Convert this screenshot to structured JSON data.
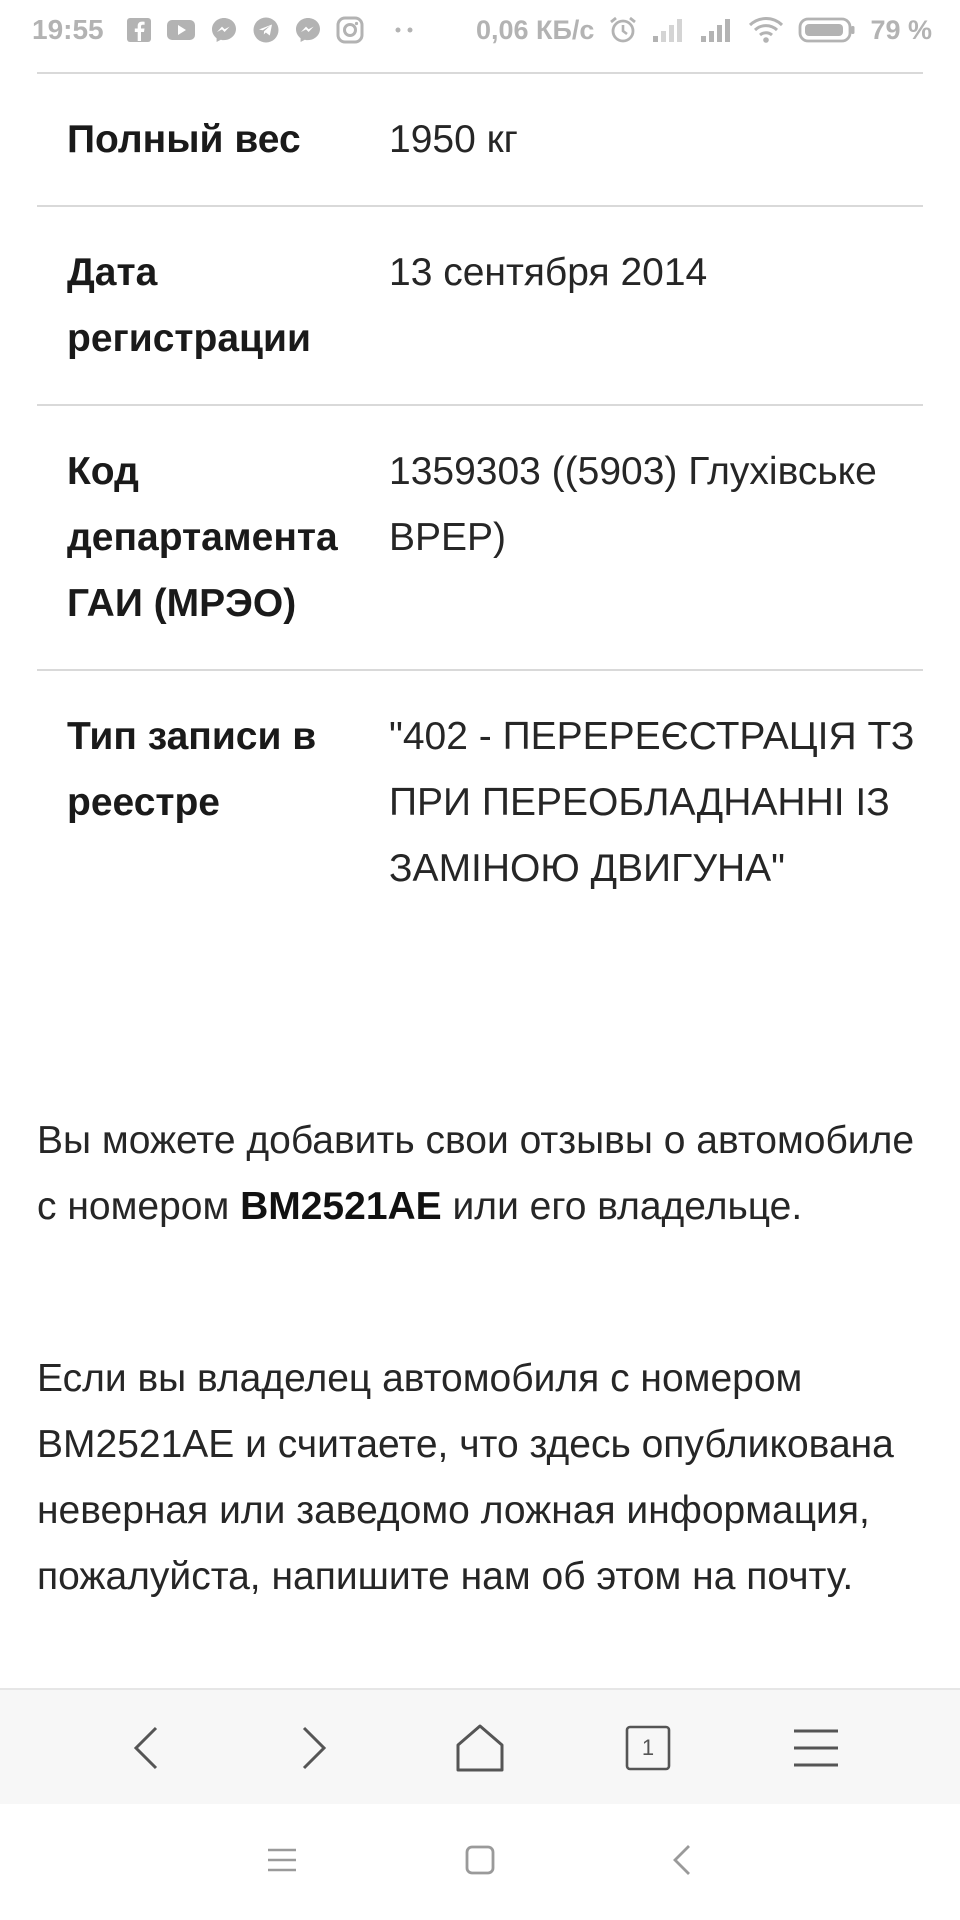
{
  "status_bar": {
    "time": "19:55",
    "network_speed": "0,06 КБ/с",
    "battery_percent": "79 %",
    "left_icons": [
      "facebook-icon",
      "youtube-icon",
      "messenger-icon",
      "telegram-icon",
      "messenger-icon",
      "instagram-icon",
      "more-notifications-icon"
    ],
    "right_icons": [
      "alarm-icon",
      "signal-icon",
      "signal-icon",
      "wifi-icon",
      "battery-icon"
    ]
  },
  "table": {
    "rows": [
      {
        "label": "Полный вес",
        "value": "1950 кг"
      },
      {
        "label": "Дата регистрации",
        "value": "13 сентября 2014"
      },
      {
        "label": "Код департамента ГАИ (МРЭО)",
        "value": "1359303 ((5903) Глухівське ВРЕР)"
      },
      {
        "label": "Тип записи в реестре",
        "value": "\"402 - ПЕРЕРЕЄСТРАЦІЯ ТЗ ПРИ ПЕРЕОБЛАДНАННІ ІЗ ЗАМІНОЮ ДВИГУНА\""
      }
    ]
  },
  "reviews_paragraph": {
    "before": "Вы можете добавить свои отзывы о автомобиле с номером ",
    "plate": "BM2521AE",
    "after": " или его владельце."
  },
  "owner_paragraph": {
    "text": "Если вы владелец автомобиля с номером BM2521AE и считаете, что здесь опубликована неверная или заведомо ложная информация, пожалуйста, напишите нам об этом на почту."
  },
  "browser_bar": {
    "tab_count": "1",
    "icons": [
      "back-icon",
      "forward-icon",
      "home-icon",
      "tabs-icon",
      "menu-icon"
    ]
  },
  "system_bar": {
    "icons": [
      "recent-apps-icon",
      "home-square-icon",
      "system-back-icon"
    ]
  },
  "colors": {
    "status_text": "#b3b3b3",
    "divider": "#d9d9d9",
    "text": "#262626",
    "browser_bar_bg": "#f7f7f7",
    "icon": "#555555"
  }
}
